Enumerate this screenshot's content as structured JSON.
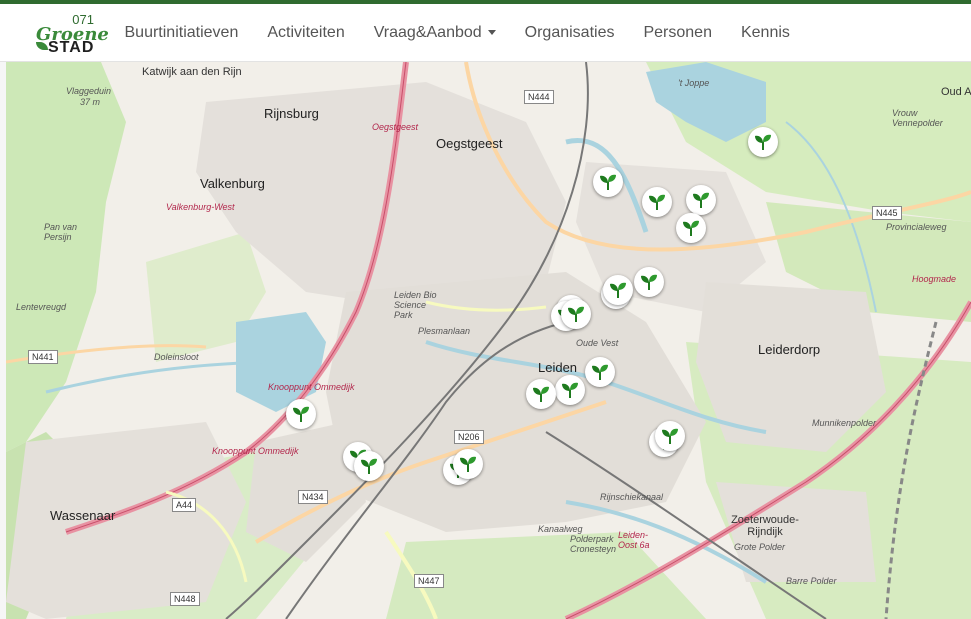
{
  "brand": {
    "number": "071",
    "word1": "Groene",
    "word2": "STAD"
  },
  "nav": [
    {
      "label": "Buurtinitiatieven"
    },
    {
      "label": "Activiteiten"
    },
    {
      "label": "Vraag&Aanbod"
    },
    {
      "label": "Organisaties"
    },
    {
      "label": "Personen"
    },
    {
      "label": "Kennis"
    }
  ],
  "map": {
    "places": {
      "oegstgeest": "Oegstgeest",
      "valkenburg": "Valkenburg",
      "rijnsburg": "Rijnsburg",
      "katwijk": "Katwijk aan den Rijn",
      "leiden": "Leiden",
      "leiderdorp": "Leiderdorp",
      "wassenaar": "Wassenaar",
      "zoeterwoude": "Zoeterwoude-Rijndijk",
      "vlaggeduin": "Vlaggeduin",
      "vlaggeduin_h": "37 m",
      "oud": "Oud A",
      "vrouw": "Vrouw Vennepolder",
      "tjoppe": "'t Joppe",
      "munnik": "Munnikenpolder",
      "grote": "Grote Polder",
      "barre": "Barre Polder",
      "polderpark": "Polderpark Cronesteyn",
      "lentevreugd": "Lentevreugd",
      "panvan": "Pan van Persijn",
      "bio": "Leiden Bio Science Park",
      "valk_west": "Valkenburg-West",
      "oegst_red": "Oegstgeest",
      "knoop1": "Knooppunt Ommedijk",
      "knoop2": "Knooppunt Ommedijk",
      "leidenoost": "Leiden-Oost 6a",
      "hoogmade": "Hoogmade",
      "plesman": "Plesmanlaan",
      "oudevest": "Oude Vest",
      "rijnkanaal": "Rijnschiekanaal",
      "kanaalweg": "Kanaalweg",
      "dolein": "Doleinsloot",
      "provinciale": "Provincialeweg"
    },
    "roads": [
      "N444",
      "N445",
      "N441",
      "N206",
      "N434",
      "A44",
      "N447",
      "N448"
    ],
    "marker_icon": "sprout-icon",
    "marker_count": 21
  }
}
